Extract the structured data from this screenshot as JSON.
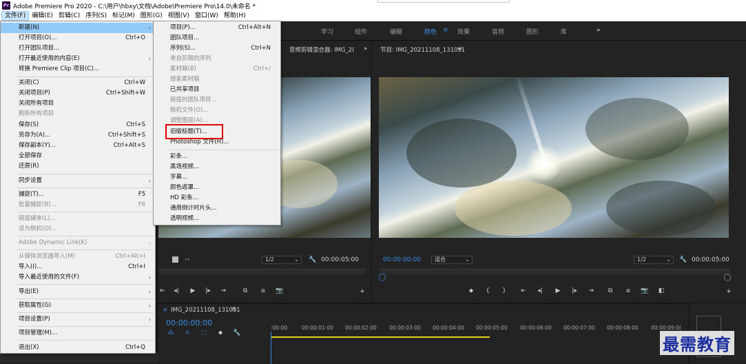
{
  "window": {
    "title": "Adobe Premiere Pro 2020 - C:\\用户\\hbxy\\文档\\Adobe\\Premiere Pro\\14.0\\未命名 *",
    "app_icon": "Pr"
  },
  "menubar": [
    "文件(F)",
    "编辑(E)",
    "剪辑(C)",
    "序列(S)",
    "标记(M)",
    "图形(G)",
    "视图(V)",
    "窗口(W)",
    "帮助(H)"
  ],
  "workspaces": [
    "学习",
    "组件",
    "编辑",
    "颜色",
    "效果",
    "音频",
    "图形",
    "库",
    "»"
  ],
  "source_panel": {
    "tab": "音频剪辑混合器: IMG_2(",
    "scale": "1/2",
    "timecode": "00:00:05:00"
  },
  "program_panel": {
    "tab": "节目: IMG_20211108_131051",
    "timecode_left": "00:00:00:00",
    "fit": "适合",
    "scale": "1/2",
    "timecode_right": "00:00:05:00"
  },
  "timeline": {
    "tab": "IMG_20211108_131051",
    "timecode": "00:00:00:00",
    "ticks": [
      ":00:00",
      "00:00:01:00",
      "00:00:02:00",
      "00:00:03:00",
      "00:00:04:00",
      "00:00:05:00",
      "00:00:06:00",
      "00:00:07:00",
      "00:00:08:00",
      "00:00:09:0("
    ]
  },
  "file_menu": [
    {
      "label": "新建(N)",
      "shortcut": "",
      "submenu": true,
      "highlighted": true
    },
    {
      "label": "打开项目(O)...",
      "shortcut": "Ctrl+O"
    },
    {
      "label": "打开团队项目...",
      "shortcut": ""
    },
    {
      "label": "打开最近使用的内容(E)",
      "shortcut": "",
      "submenu": true
    },
    {
      "label": "转换 Premiere Clip 项目(C)...",
      "shortcut": ""
    },
    {
      "label": "关闭(C)",
      "shortcut": "Ctrl+W"
    },
    {
      "label": "关闭项目(P)",
      "shortcut": "Ctrl+Shift+W"
    },
    {
      "label": "关闭所有项目",
      "shortcut": ""
    },
    {
      "label": "刷新所有项目",
      "shortcut": "",
      "disabled": true
    },
    {
      "label": "保存(S)",
      "shortcut": "Ctrl+S"
    },
    {
      "label": "另存为(A)...",
      "shortcut": "Ctrl+Shift+S"
    },
    {
      "label": "保存副本(Y)...",
      "shortcut": "Ctrl+Alt+S"
    },
    {
      "label": "全部保存",
      "shortcut": ""
    },
    {
      "label": "还原(R)",
      "shortcut": ""
    },
    {
      "label": "同步设置",
      "shortcut": "",
      "submenu": true
    },
    {
      "label": "捕捉(T)...",
      "shortcut": "F5"
    },
    {
      "label": "批量捕捉(B)...",
      "shortcut": "F6",
      "disabled": true
    },
    {
      "label": "链接媒体(L)...",
      "shortcut": "",
      "disabled": true
    },
    {
      "label": "设为脱机(O)...",
      "shortcut": "",
      "disabled": true
    },
    {
      "label": "Adobe Dynamic Link(K)",
      "shortcut": "",
      "submenu": true,
      "disabled": true
    },
    {
      "label": "从媒体浏览器导入(M)",
      "shortcut": "Ctrl+Alt+I",
      "disabled": true
    },
    {
      "label": "导入(I)...",
      "shortcut": "Ctrl+I"
    },
    {
      "label": "导入最近使用的文件(F)",
      "shortcut": "",
      "submenu": true
    },
    {
      "label": "导出(E)",
      "shortcut": "",
      "submenu": true
    },
    {
      "label": "获取属性(G)",
      "shortcut": "",
      "submenu": true
    },
    {
      "label": "项目设置(P)",
      "shortcut": "",
      "submenu": true
    },
    {
      "label": "项目管理(M)...",
      "shortcut": ""
    },
    {
      "label": "退出(X)",
      "shortcut": "Ctrl+Q"
    }
  ],
  "new_menu": [
    {
      "label": "项目(P)...",
      "shortcut": "Ctrl+Alt+N"
    },
    {
      "label": "团队项目...",
      "shortcut": ""
    },
    {
      "label": "序列(S)...",
      "shortcut": "Ctrl+N"
    },
    {
      "label": "来自剪辑的序列",
      "shortcut": "",
      "disabled": true
    },
    {
      "label": "素材箱(B)",
      "shortcut": "Ctrl+/",
      "disabled": true
    },
    {
      "label": "搜索素材箱",
      "shortcut": "",
      "disabled": true
    },
    {
      "label": "已共享项目",
      "shortcut": ""
    },
    {
      "label": "链接的团队项目...",
      "shortcut": "",
      "disabled": true
    },
    {
      "label": "脱机文件(O)...",
      "shortcut": "",
      "disabled": true
    },
    {
      "label": "调整图层(A)...",
      "shortcut": "",
      "disabled": true
    },
    {
      "label": "旧版标题(T)...",
      "shortcut": "",
      "boxed": true
    },
    {
      "label": "Photoshop 文件(H)...",
      "shortcut": ""
    },
    {
      "label": "彩条...",
      "shortcut": ""
    },
    {
      "label": "黑场视频...",
      "shortcut": ""
    },
    {
      "label": "字幕...",
      "shortcut": ""
    },
    {
      "label": "颜色遮罩...",
      "shortcut": ""
    },
    {
      "label": "HD 彩条...",
      "shortcut": ""
    },
    {
      "label": "通用倒计时片头...",
      "shortcut": ""
    },
    {
      "label": "透明视频...",
      "shortcut": ""
    }
  ],
  "watermark": "最需教育",
  "colors": {
    "accent_blue": "#3a8ee6",
    "highlight_red": "#e00000",
    "menu_highlight": "#91c9f7"
  }
}
